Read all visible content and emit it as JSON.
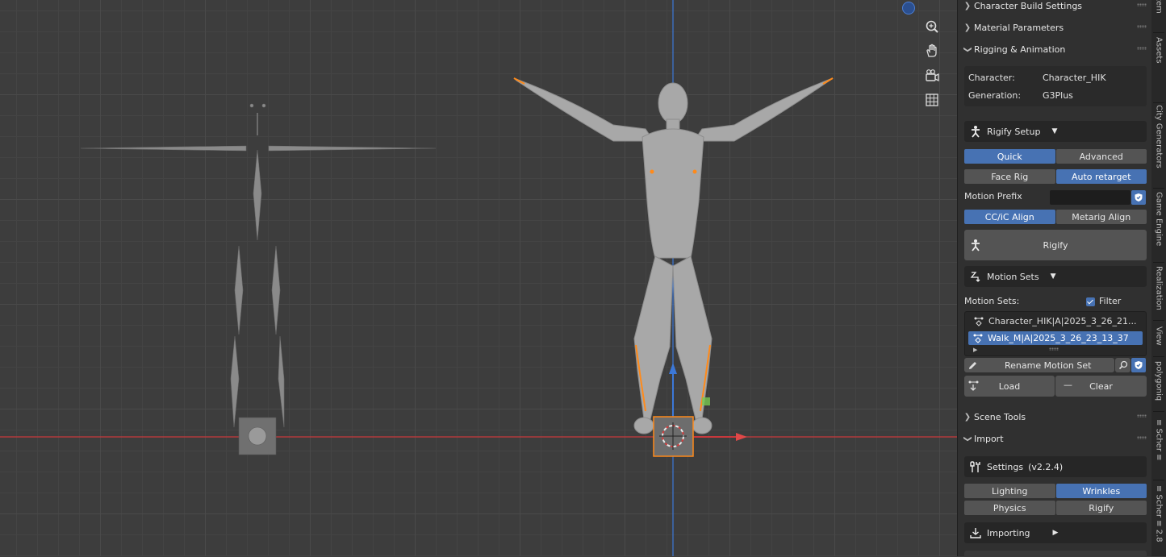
{
  "viewport": {
    "tools": [
      {
        "name": "zoom-icon"
      },
      {
        "name": "hand-pan-icon"
      },
      {
        "name": "camera-view-icon"
      },
      {
        "name": "grid-perspective-icon"
      }
    ],
    "colors": {
      "x_axis": "#c8383c",
      "y_axis": "#3c78d8",
      "selection": "#ff8a1a"
    }
  },
  "panel": {
    "sections": {
      "character_build": "Character Build Settings",
      "material": "Material Parameters",
      "rigging": "Rigging & Animation",
      "scene_tools": "Scene Tools",
      "import": "Import"
    },
    "character": {
      "label": "Character:",
      "value": "Character_HIK"
    },
    "generation": {
      "label": "Generation:",
      "value": "G3Plus"
    },
    "rigify_setup": {
      "title": "Rigify Setup"
    },
    "mode": {
      "quick": "Quick",
      "advanced": "Advanced"
    },
    "rig_opts": {
      "face_rig": "Face Rig",
      "auto_retarget": "Auto retarget"
    },
    "motion_prefix": {
      "label": "Motion Prefix",
      "value": ""
    },
    "align": {
      "cc": "CC/iC Align",
      "metarig": "Metarig Align"
    },
    "rigify_button": "Rigify",
    "motion_sets": {
      "title": "Motion Sets",
      "list_label": "Motion Sets:",
      "filter": "Filter",
      "items": [
        "Character_HIK|A|2025_3_26_21...",
        "Walk_M|A|2025_3_26_23_13_37"
      ],
      "rename": "Rename Motion Set",
      "load": "Load",
      "minus": "—",
      "clear": "Clear"
    },
    "settings": {
      "title": "Settings",
      "version": "(v2.2.4)"
    },
    "import_opts": {
      "lighting": "Lighting",
      "wrinkles": "Wrinkles",
      "physics": "Physics",
      "rigify": "Rigify"
    },
    "importing": {
      "title": "Importing"
    }
  },
  "tabs": [
    "Item",
    "Assets",
    "City Generators",
    "Game Engine",
    "Realization",
    "View",
    "polygoniq",
    "≡ Scher ≡",
    "≡ Scher ≡ 2.8"
  ]
}
